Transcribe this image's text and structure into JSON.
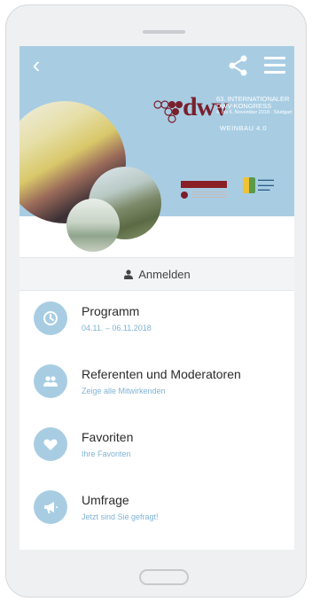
{
  "header": {
    "back_icon": "chevron-left-icon",
    "share_icon": "share-icon",
    "menu_icon": "hamburger-menu-icon"
  },
  "banner": {
    "logo_text": "dwv",
    "line1": "63. INTERNATIONALER DWV-KONGRESS",
    "line2": "4. bis 6. November 2018 · Stuttgart",
    "line3": "WEINBAU 4.0"
  },
  "login": {
    "label": "Anmelden",
    "icon": "user-plus-icon"
  },
  "menu": [
    {
      "title": "Programm",
      "subtitle": "04.11. – 06.11.2018",
      "icon": "clock-icon"
    },
    {
      "title": "Referenten und Moderatoren",
      "subtitle": "Zeige alle Mitwirkenden",
      "icon": "people-icon"
    },
    {
      "title": "Favoriten",
      "subtitle": "Ihre Favoriten",
      "icon": "heart-icon"
    },
    {
      "title": "Umfrage",
      "subtitle": "Jetzt sind Sie gefragt!",
      "icon": "megaphone-icon"
    }
  ],
  "colors": {
    "accent": "#a8cde3",
    "subtitle": "#7fb3d5",
    "brand": "#7a1f2c"
  }
}
